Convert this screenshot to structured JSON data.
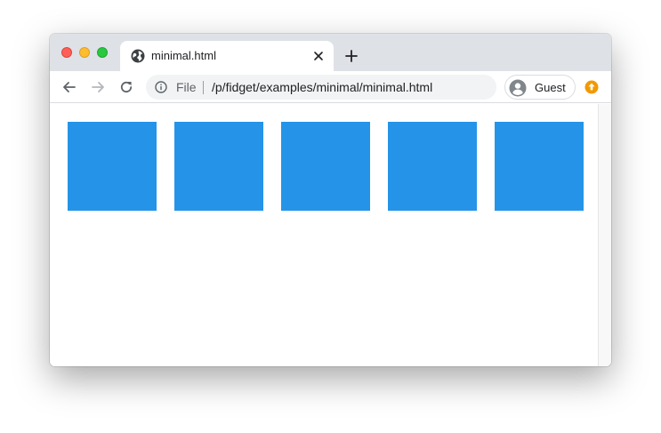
{
  "tab": {
    "title": "minimal.html",
    "favicon": "globe-icon"
  },
  "omnibox": {
    "scheme_label": "File",
    "url": "/p/fidget/examples/minimal/minimal.html",
    "info_icon": "info-icon"
  },
  "profile": {
    "label": "Guest",
    "icon": "person-icon"
  },
  "content": {
    "squares": [
      {
        "color": "#2594e8"
      },
      {
        "color": "#2594e8"
      },
      {
        "color": "#2594e8"
      },
      {
        "color": "#2594e8"
      },
      {
        "color": "#2594e8"
      }
    ]
  },
  "colors": {
    "accent_update": "#f29900",
    "square": "#2594e8"
  }
}
